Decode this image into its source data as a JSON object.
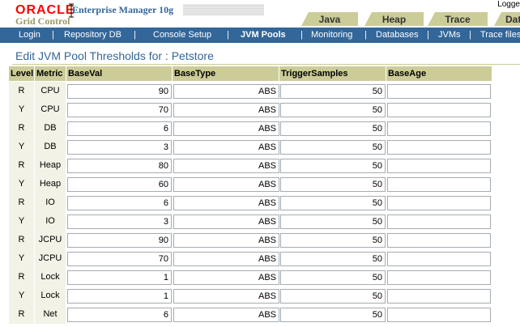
{
  "header": {
    "brand": "ORACLE",
    "product": "Enterprise Manager 10g",
    "subtitle": "Grid Control",
    "logged": "Logge"
  },
  "tabs": [
    {
      "label": "Java"
    },
    {
      "label": "Heap"
    },
    {
      "label": "Trace"
    },
    {
      "label": "Datab"
    }
  ],
  "nav": [
    {
      "label": "Login"
    },
    {
      "label": "Repository DB"
    },
    {
      "label": "Console Setup"
    },
    {
      "label": "JVM Pools"
    },
    {
      "label": "Monitoring"
    },
    {
      "label": "Databases"
    },
    {
      "label": "JVMs"
    },
    {
      "label": "Trace files"
    }
  ],
  "page": {
    "title": "Edit JVM Pool Thresholds for : Petstore"
  },
  "table": {
    "columns": [
      "Level",
      "Metric",
      "BaseVal",
      "BaseType",
      "TriggerSamples",
      "BaseAge"
    ],
    "rows": [
      {
        "level": "R",
        "metric": "CPU",
        "baseval": "90",
        "basetype": "ABS",
        "samples": "50",
        "baseage": ""
      },
      {
        "level": "Y",
        "metric": "CPU",
        "baseval": "70",
        "basetype": "ABS",
        "samples": "50",
        "baseage": ""
      },
      {
        "level": "R",
        "metric": "DB",
        "baseval": "6",
        "basetype": "ABS",
        "samples": "50",
        "baseage": ""
      },
      {
        "level": "Y",
        "metric": "DB",
        "baseval": "3",
        "basetype": "ABS",
        "samples": "50",
        "baseage": ""
      },
      {
        "level": "R",
        "metric": "Heap",
        "baseval": "80",
        "basetype": "ABS",
        "samples": "50",
        "baseage": ""
      },
      {
        "level": "Y",
        "metric": "Heap",
        "baseval": "60",
        "basetype": "ABS",
        "samples": "50",
        "baseage": ""
      },
      {
        "level": "R",
        "metric": "IO",
        "baseval": "6",
        "basetype": "ABS",
        "samples": "50",
        "baseage": ""
      },
      {
        "level": "Y",
        "metric": "IO",
        "baseval": "3",
        "basetype": "ABS",
        "samples": "50",
        "baseage": ""
      },
      {
        "level": "R",
        "metric": "JCPU",
        "baseval": "90",
        "basetype": "ABS",
        "samples": "50",
        "baseage": ""
      },
      {
        "level": "Y",
        "metric": "JCPU",
        "baseval": "70",
        "basetype": "ABS",
        "samples": "50",
        "baseage": ""
      },
      {
        "level": "R",
        "metric": "Lock",
        "baseval": "1",
        "basetype": "ABS",
        "samples": "50",
        "baseage": ""
      },
      {
        "level": "Y",
        "metric": "Lock",
        "baseval": "1",
        "basetype": "ABS",
        "samples": "50",
        "baseage": ""
      },
      {
        "level": "R",
        "metric": "Net",
        "baseval": "6",
        "basetype": "ABS",
        "samples": "50",
        "baseage": ""
      }
    ]
  },
  "colors": {
    "nav_bg": "#336699",
    "tab_bg": "#cccc99",
    "header_row_bg": "#cccc99",
    "cell_bg": "#f2f2e6",
    "brand": "#ff0000"
  }
}
